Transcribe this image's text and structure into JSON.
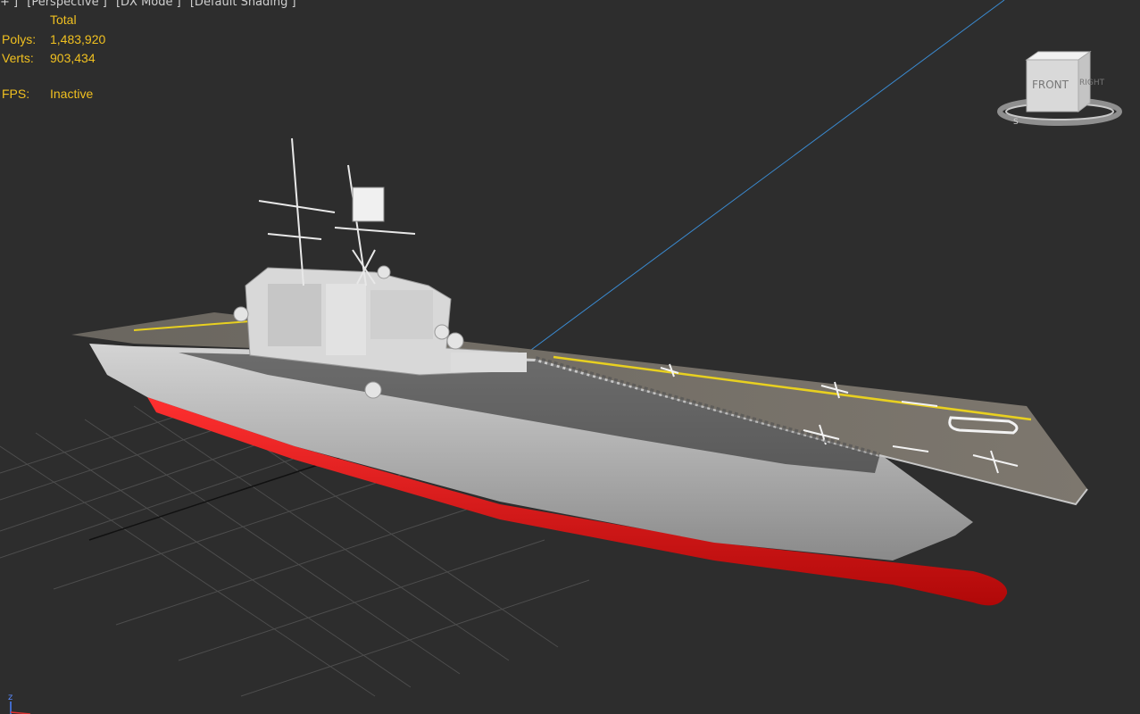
{
  "viewport": {
    "labels": [
      "+ ]",
      "[Perspective ]",
      "[DX Mode ]",
      "[Default Shading ]"
    ]
  },
  "stats": {
    "header": "Total",
    "polys_label": "Polys:",
    "polys_value": "1,483,920",
    "verts_label": "Verts:",
    "verts_value": "903,434",
    "fps_label": "FPS:",
    "fps_value": "Inactive"
  },
  "viewcube": {
    "front_label": "FRONT",
    "right_label": "RIGHT",
    "compass_label": "S"
  },
  "axis_tripod": {
    "z_label": "z"
  },
  "colors": {
    "background": "#2d2d2d",
    "stats_text": "#f0c020",
    "grid": "#4a4a4a",
    "hull_gray": "#b8b8b8",
    "hull_red": "#e01515",
    "deck": "#6e6a64",
    "deck_yellow_line": "#e8d020",
    "camera_line": "#3a8ad0"
  }
}
